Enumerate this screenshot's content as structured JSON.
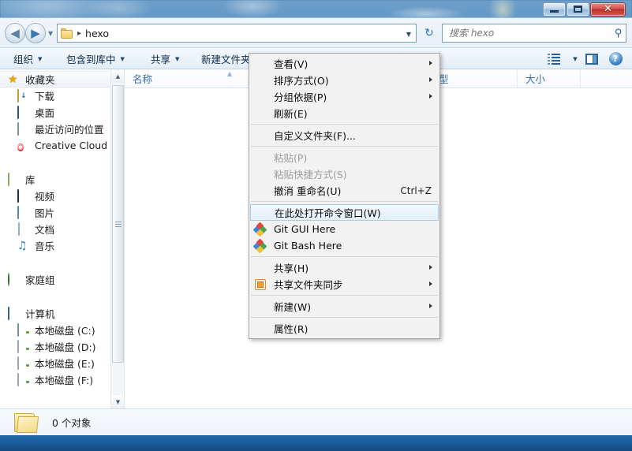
{
  "window": {
    "title": "hexo",
    "buttons": {
      "minimize": "—",
      "maximize": "❐",
      "close": "✕"
    }
  },
  "address_bar": {
    "back_label": "◀",
    "forward_label": "▶",
    "history_caret": "▼",
    "folder_icon": "folder-icon",
    "crumb_separator": "▸",
    "path": "hexo",
    "dropdown_caret": "▼",
    "refresh_label": "↻"
  },
  "search": {
    "placeholder": "搜索 hexo",
    "value": "",
    "icon": "search-icon"
  },
  "toolbar": {
    "items": [
      {
        "label": "组织",
        "caret": "▼"
      },
      {
        "label": "包含到库中",
        "caret": "▼"
      },
      {
        "label": "共享",
        "caret": "▼"
      },
      {
        "label": "新建文件夹",
        "caret": ""
      }
    ],
    "view_caret": "▼",
    "view_icon": "view-mode-icon",
    "preview_icon": "preview-pane-icon",
    "help_icon": "help-icon",
    "help_label": "?"
  },
  "navpane": {
    "scroll_up": "▲",
    "scroll_down": "▼",
    "groups": [
      {
        "header": {
          "label": "收藏夹",
          "icon": "star-icon"
        },
        "items": [
          {
            "label": "下载",
            "icon": "downloads-folder-icon"
          },
          {
            "label": "桌面",
            "icon": "desktop-icon"
          },
          {
            "label": "最近访问的位置",
            "icon": "recent-places-icon"
          },
          {
            "label": "Creative Cloud",
            "icon": "creative-cloud-icon"
          }
        ]
      },
      {
        "header": {
          "label": "库",
          "icon": "library-icon"
        },
        "items": [
          {
            "label": "视频",
            "icon": "videos-icon"
          },
          {
            "label": "图片",
            "icon": "pictures-icon"
          },
          {
            "label": "文档",
            "icon": "documents-icon"
          },
          {
            "label": "音乐",
            "icon": "music-icon"
          }
        ]
      },
      {
        "header": {
          "label": "家庭组",
          "icon": "homegroup-icon"
        },
        "items": []
      },
      {
        "header": {
          "label": "计算机",
          "icon": "computer-icon"
        },
        "items": [
          {
            "label": "本地磁盘 (C:)",
            "icon": "system-drive-icon"
          },
          {
            "label": "本地磁盘 (D:)",
            "icon": "drive-icon"
          },
          {
            "label": "本地磁盘 (E:)",
            "icon": "drive-icon"
          },
          {
            "label": "本地磁盘 (F:)",
            "icon": "drive-icon"
          }
        ]
      }
    ]
  },
  "filelist": {
    "columns": [
      {
        "label": "名称",
        "sort_marker": "▲"
      },
      {
        "label": "型",
        "sort_marker": ""
      },
      {
        "label": "大小",
        "sort_marker": ""
      },
      {
        "label": "",
        "sort_marker": ""
      }
    ],
    "rows": []
  },
  "context_menu": {
    "items": [
      {
        "label": "查看(V)",
        "submenu": true,
        "icon": null,
        "accel": "",
        "state": "normal"
      },
      {
        "label": "排序方式(O)",
        "submenu": true,
        "icon": null,
        "accel": "",
        "state": "normal"
      },
      {
        "label": "分组依据(P)",
        "submenu": true,
        "icon": null,
        "accel": "",
        "state": "normal"
      },
      {
        "label": "刷新(E)",
        "submenu": false,
        "icon": null,
        "accel": "",
        "state": "normal"
      },
      {
        "separator": true
      },
      {
        "label": "自定义文件夹(F)...",
        "submenu": false,
        "icon": null,
        "accel": "",
        "state": "normal"
      },
      {
        "separator": true
      },
      {
        "label": "粘贴(P)",
        "submenu": false,
        "icon": null,
        "accel": "",
        "state": "disabled"
      },
      {
        "label": "粘贴快捷方式(S)",
        "submenu": false,
        "icon": null,
        "accel": "",
        "state": "disabled"
      },
      {
        "label": "撤消 重命名(U)",
        "submenu": false,
        "icon": null,
        "accel": "Ctrl+Z",
        "state": "normal"
      },
      {
        "separator": true
      },
      {
        "label": "在此处打开命令窗口(W)",
        "submenu": false,
        "icon": null,
        "accel": "",
        "state": "selected"
      },
      {
        "label": "Git GUI Here",
        "submenu": false,
        "icon": "git-icon",
        "accel": "",
        "state": "normal"
      },
      {
        "label": "Git Bash Here",
        "submenu": false,
        "icon": "git-icon",
        "accel": "",
        "state": "normal"
      },
      {
        "separator": true
      },
      {
        "label": "共享(H)",
        "submenu": true,
        "icon": null,
        "accel": "",
        "state": "normal"
      },
      {
        "label": "共享文件夹同步",
        "submenu": true,
        "icon": "folder-sync-icon",
        "accel": "",
        "state": "normal"
      },
      {
        "separator": true
      },
      {
        "label": "新建(W)",
        "submenu": true,
        "icon": null,
        "accel": "",
        "state": "normal"
      },
      {
        "separator": true
      },
      {
        "label": "属性(R)",
        "submenu": false,
        "icon": null,
        "accel": "",
        "state": "normal"
      }
    ]
  },
  "status_bar": {
    "icon": "folder-icon",
    "text": "0 个对象"
  },
  "colors": {
    "accent": "#3a6ea5",
    "selection_bg": "#e4f0fb",
    "selection_border": "#a8cdea",
    "close_button": "#b52f28"
  }
}
